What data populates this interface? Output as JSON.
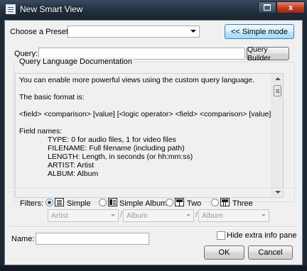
{
  "window": {
    "title": "New Smart View",
    "close_glyph": "x"
  },
  "preset": {
    "label": "Choose a Preset:",
    "value": ""
  },
  "simple_mode_button": "<< Simple mode",
  "query": {
    "label": "Query:",
    "value": "",
    "builder_button": "Query Builder"
  },
  "doc": {
    "group_label": "Query Language Documentation",
    "lines": [
      "You can enable more powerful views using the custom query language.",
      "The basic format is:",
      "<field> <comparison> [value] [<logic operator> <field> <comparison> [value] [...]]",
      "Field names:",
      "TYPE: 0 for audio files, 1 for video files",
      "FILENAME: Full filename (including path)",
      "LENGTH: Length, in seconds (or hh:mm:ss)",
      "ARTIST: Artist",
      "ALBUM: Album"
    ]
  },
  "filters": {
    "label": "Filters:",
    "options": [
      "Simple",
      "Simple Album",
      "Two",
      "Three"
    ],
    "selected": "Simple",
    "fields": [
      "Artist",
      "Album",
      "Album"
    ],
    "separator": "/"
  },
  "name": {
    "label": "Name:",
    "value": ""
  },
  "hide_info": {
    "label": "Hide extra info pane",
    "checked": false
  },
  "buttons": {
    "ok": "OK",
    "cancel": "Cancel"
  },
  "icons": [
    "app-icon",
    "restore-icon",
    "close-icon",
    "dropdown-arrow-icon",
    "simple-layout-icon",
    "simple-album-layout-icon",
    "two-column-layout-icon",
    "three-column-layout-icon"
  ],
  "colors": {
    "title_bar": "#23303f",
    "dialog_bg": "#f0f0f0",
    "close_button": "#c23b22",
    "default_button_border": "#3c7fb1"
  }
}
